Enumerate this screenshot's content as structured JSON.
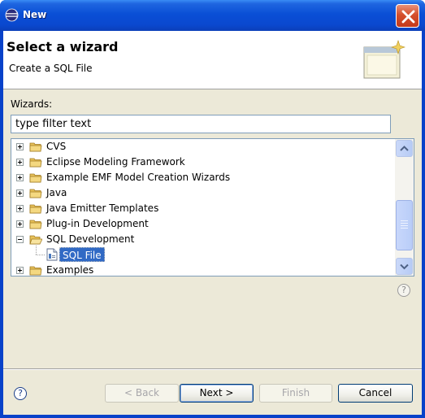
{
  "window": {
    "title": "New",
    "close_icon": "close-icon"
  },
  "banner": {
    "title": "Select a wizard",
    "description": "Create a SQL File",
    "icon": "wizard-banner-icon"
  },
  "wizards": {
    "label": "Wizards:",
    "filter_placeholder": "type filter text",
    "filter_value": ""
  },
  "tree": {
    "items": [
      {
        "label": "CVS",
        "expanded": false,
        "icon": "folder-icon"
      },
      {
        "label": "Eclipse Modeling Framework",
        "expanded": false,
        "icon": "folder-icon"
      },
      {
        "label": "Example EMF Model Creation Wizards",
        "expanded": false,
        "icon": "folder-icon"
      },
      {
        "label": "Java",
        "expanded": false,
        "icon": "folder-icon"
      },
      {
        "label": "Java Emitter Templates",
        "expanded": false,
        "icon": "folder-icon"
      },
      {
        "label": "Plug-in Development",
        "expanded": false,
        "icon": "folder-icon"
      },
      {
        "label": "SQL Development",
        "expanded": true,
        "icon": "folder-open-icon"
      },
      {
        "label": "SQL File",
        "selected": true,
        "icon": "sql-file-icon"
      },
      {
        "label": "Examples",
        "expanded": false,
        "icon": "folder-icon"
      }
    ]
  },
  "buttons": {
    "back": "< Back",
    "next": "Next >",
    "finish": "Finish",
    "cancel": "Cancel"
  },
  "help": {
    "icon": "help-icon",
    "glyph": "?"
  },
  "colors": {
    "titlebar": "#0a4fd6",
    "selection": "#316ac5",
    "dialog_bg": "#ece9d8",
    "close_button": "#d5502c"
  }
}
